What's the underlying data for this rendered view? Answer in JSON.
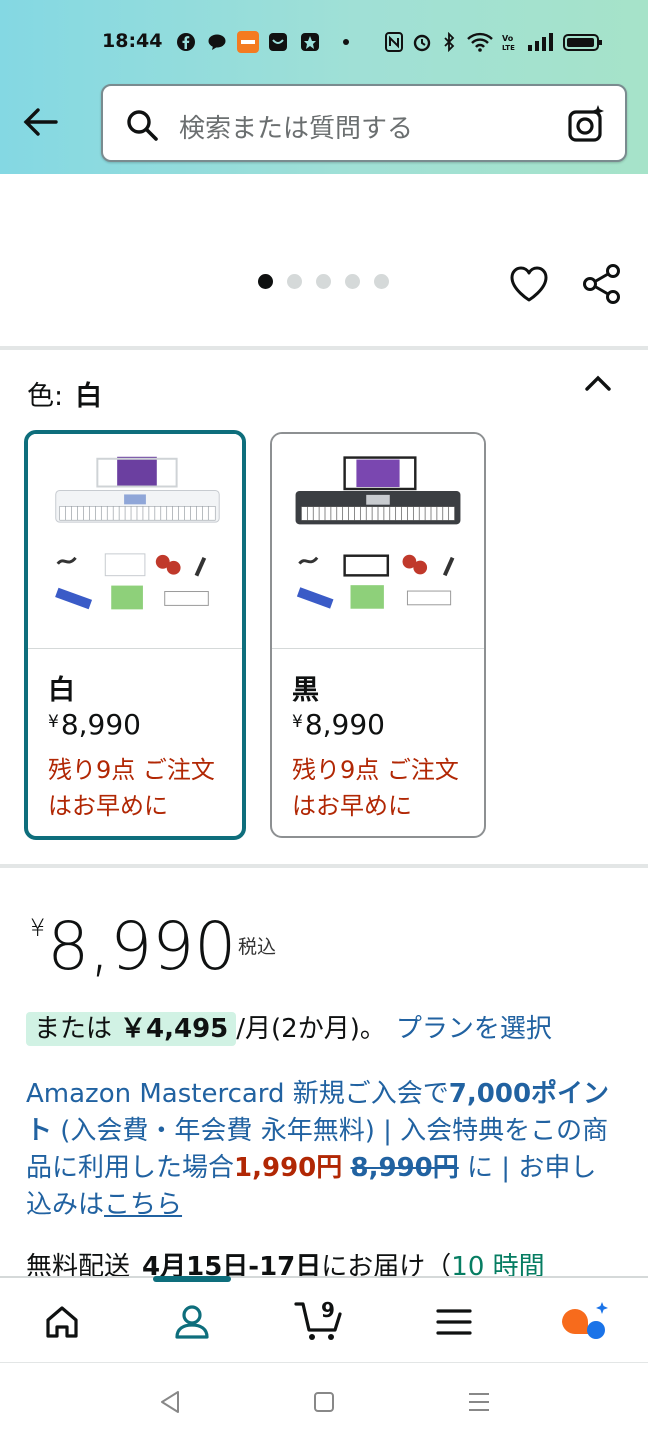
{
  "status_bar": {
    "time": "18:44"
  },
  "search": {
    "placeholder": "検索または質問する"
  },
  "gallery": {
    "dot_count": 5,
    "active_index": 0
  },
  "color": {
    "label": "色:",
    "selected": "白",
    "options": [
      {
        "name": "白",
        "currency": "¥",
        "price": "8,990",
        "stock": "残り9点 ご注文はお早めに"
      },
      {
        "name": "黒",
        "currency": "¥",
        "price": "8,990",
        "stock": "残り9点 ご注文はお早めに"
      }
    ]
  },
  "price": {
    "currency": "¥",
    "amount": "8,990",
    "tax_note": "税込"
  },
  "installment": {
    "prefix": "または",
    "amount": "￥4,495",
    "period": "/月(2か月)。",
    "plan_link": "プランを選択"
  },
  "promo": {
    "part1": "Amazon Mastercard 新規ご入会で",
    "points": "7,000ポイント",
    "part2": " (入会費・年会費 永年無料) | 入会特典をこの商品に利用した場合",
    "discounted": "1,990円",
    "original": "8,990円",
    "part3": " に | お申し込みは",
    "link": "こちら"
  },
  "delivery": {
    "label": "無料配送",
    "date": "4月15日-17日",
    "suffix": "にお届け（",
    "time_left": "10 時間"
  },
  "bottom_nav": {
    "cart_count": "9"
  }
}
